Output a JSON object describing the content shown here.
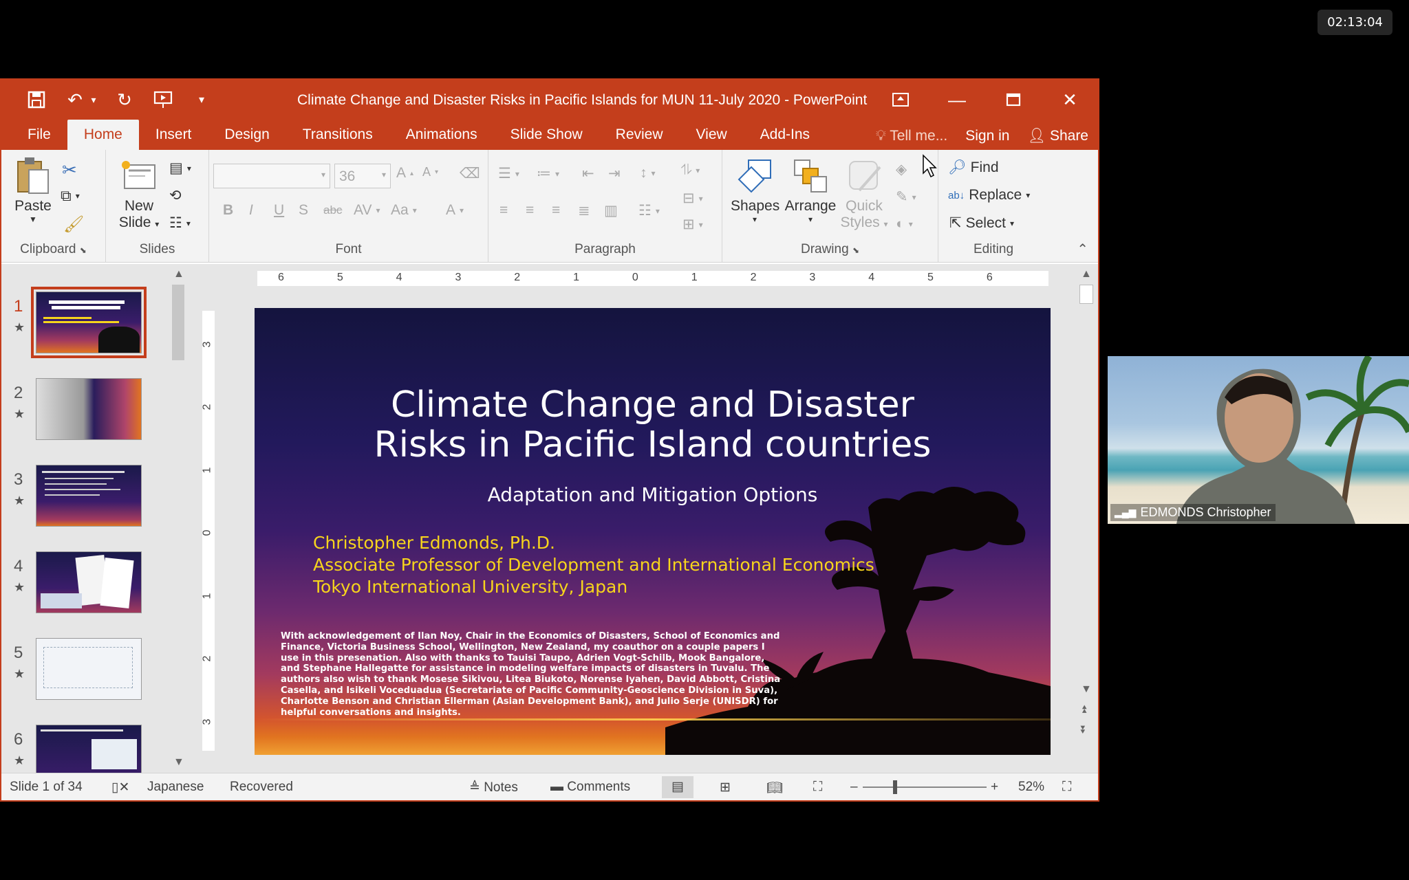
{
  "clock": "02:13:04",
  "window": {
    "title": "Climate Change and Disaster Risks in Pacific Islands for MUN 11-July 2020 - PowerPoint"
  },
  "menu": {
    "tabs": [
      "File",
      "Home",
      "Insert",
      "Design",
      "Transitions",
      "Animations",
      "Slide Show",
      "Review",
      "View",
      "Add-Ins"
    ],
    "tell_me": "Tell me...",
    "sign_in": "Sign in",
    "share": "Share"
  },
  "ribbon": {
    "clipboard": {
      "label": "Clipboard",
      "paste": "Paste"
    },
    "slides": {
      "label": "Slides",
      "new_slide_1": "New",
      "new_slide_2": "Slide"
    },
    "font": {
      "label": "Font",
      "size": "36"
    },
    "paragraph": {
      "label": "Paragraph"
    },
    "drawing": {
      "label": "Drawing",
      "shapes": "Shapes",
      "arrange": "Arrange",
      "quick_1": "Quick",
      "quick_2": "Styles"
    },
    "editing": {
      "label": "Editing",
      "find": "Find",
      "replace": "Replace",
      "select": "Select"
    }
  },
  "thumbnails": [
    {
      "num": "1"
    },
    {
      "num": "2"
    },
    {
      "num": "3"
    },
    {
      "num": "4"
    },
    {
      "num": "5"
    },
    {
      "num": "6"
    }
  ],
  "ruler": {
    "h_ticks": [
      "6",
      "5",
      "4",
      "3",
      "2",
      "1",
      "0",
      "1",
      "2",
      "3",
      "4",
      "5",
      "6"
    ],
    "v_ticks": [
      "3",
      "2",
      "1",
      "0",
      "1",
      "2",
      "3"
    ]
  },
  "slide": {
    "title_line1": "Climate Change and Disaster",
    "title_line2": "Risks in Pacific Island countries",
    "subtitle": "Adaptation and Mitigation Options",
    "author": "Christopher Edmonds, Ph.D.",
    "position": "Associate Professor of Development and International Economics",
    "affiliation": "Tokyo International University, Japan",
    "acknowledgement": "With acknowledgement of Ilan Noy, Chair in the Economics of Disasters, School of Economics and Finance, Victoria Business School, Wellington, New Zealand, my coauthor on a couple papers I use in this presenation. Also with thanks to Tauisi Taupo, Adrien Vogt-Schilb, Mook Bangalore, and Stephane Hallegatte for assistance in modeling welfare impacts of disasters in Tuvalu. The authors also wish to thank Mosese Sikivou, Litea Biukoto, Norense Iyahen, David Abbott, Cristina Casella, and Isikeli Voceduadua (Secretariate of Pacific Community-Geoscience Division in Suva), Charlotte Benson and Christian Ellerman (Asian Development Bank), and Julio Serje (UNISDR) for helpful conversations and insights."
  },
  "status": {
    "slide_of": "Slide 1 of 34",
    "language": "Japanese",
    "recovered": "Recovered",
    "notes": "Notes",
    "comments": "Comments",
    "zoom": "52%"
  },
  "webcam": {
    "name": "EDMONDS Christopher"
  },
  "colors": {
    "accent": "#c43e1c",
    "slide_text_yellow": "#f7d41c"
  }
}
